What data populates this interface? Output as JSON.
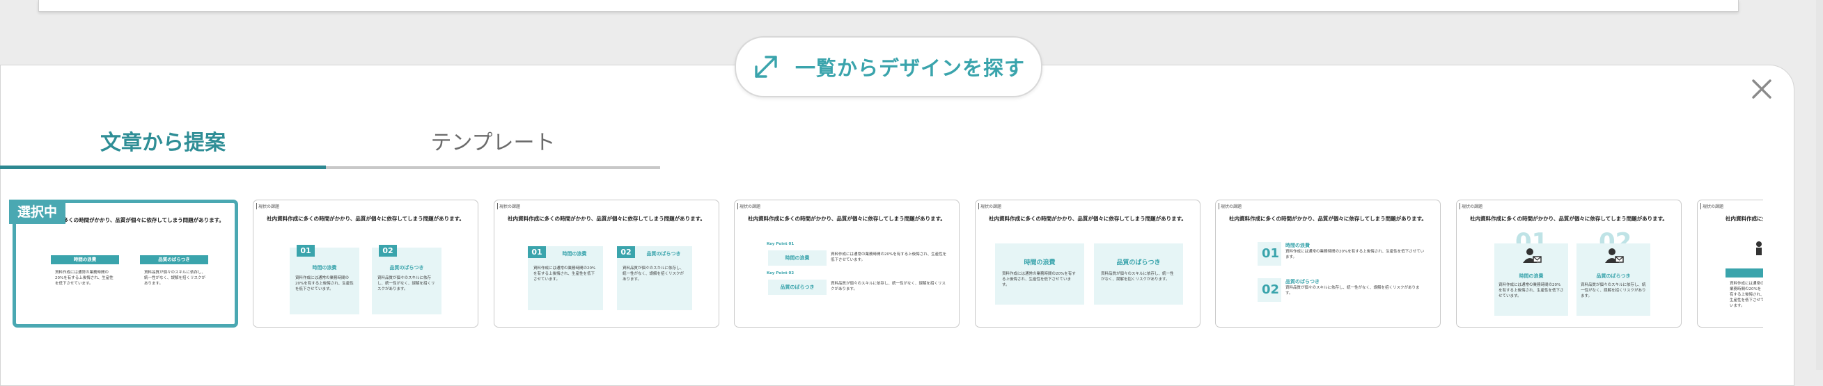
{
  "expand_pill": {
    "label": "一覧からデザインを探す",
    "icon": "expand-arrows-icon"
  },
  "close_icon": "close-icon",
  "tabs": [
    {
      "label": "文章から提案",
      "active": true
    },
    {
      "label": "テンプレート",
      "active": false
    }
  ],
  "selected_badge": "選択中",
  "slide": {
    "tag": "現状の課題",
    "title": "社内資料作成に多くの時間がかかり、品質が個々に依存してしまう問題があります。",
    "item1_head": "時間の浪費",
    "item2_head": "品質のばらつき",
    "item1_text": "資料作成には通常の業務時間の20%を有する上後悔され、生産性を低下させています。",
    "item2_text": "資料品質が個々のスキルに依存し、統一性がなく、誤解を招くリスクがあります。",
    "num1": "01",
    "num2": "02",
    "kw1": "Key Point 01",
    "kw2": "Key Point 02"
  },
  "colors": {
    "accent": "#3aa4ac",
    "tab_active": "#2f8e96",
    "badge": "#4aa8b2"
  }
}
